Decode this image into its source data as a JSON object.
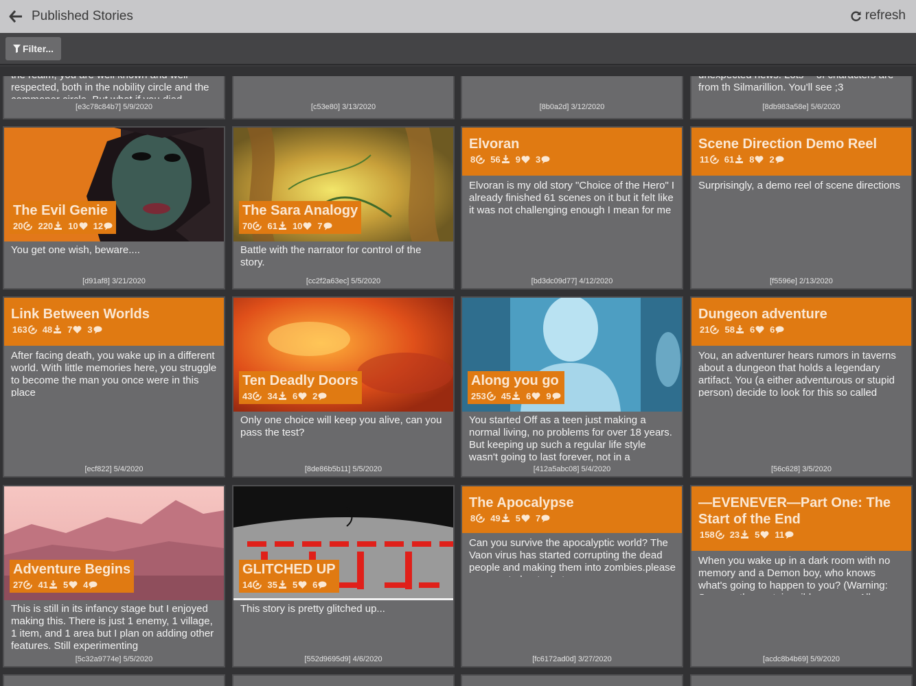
{
  "header": {
    "title": "Published Stories",
    "refresh_label": "refresh"
  },
  "toolbar": {
    "filter_label": "Filter..."
  },
  "partial_cards": [
    {
      "desc": "the realm, you are well known and well respected, both in the nobility circle and the commoner circle. But what if you died",
      "meta": "[e3c78c84b7] 5/9/2020"
    },
    {
      "desc": "",
      "meta": "[c53e80] 3/13/2020"
    },
    {
      "desc": "",
      "meta": "[8b0a2d] 3/12/2020"
    },
    {
      "desc": "unexpected news. Lots -- of characters are from th Silmarillion. You'll see ;3",
      "meta": "[8db983a58e] 5/6/2020"
    }
  ],
  "stories": [
    {
      "title": "The Evil Genie",
      "plays": "20",
      "downloads": "220",
      "likes": "10",
      "comments": "12",
      "desc": "You get one wish, beware....",
      "meta": "[d91af8] 3/21/2020"
    },
    {
      "title": "The Sara Analogy",
      "plays": "70",
      "downloads": "61",
      "likes": "10",
      "comments": "7",
      "desc": "Battle with the narrator for control of the story.",
      "meta": "[cc2f2a63ec] 5/5/2020"
    },
    {
      "title": "Elvoran",
      "plays": "8",
      "downloads": "56",
      "likes": "9",
      "comments": "3",
      "desc": "Elvoran is my old story \"Choice of the Hero\" I already finished 61 scenes on it but it felt like it was not challenging enough I mean for me it lacked challenge and",
      "meta": "[bd3dc09d77] 4/12/2020"
    },
    {
      "title": "Scene Direction Demo Reel",
      "plays": "11",
      "downloads": "61",
      "likes": "8",
      "comments": "2",
      "desc": "Surprisingly, a demo reel of scene directions",
      "meta": "[f5596e] 2/13/2020"
    },
    {
      "title": "Link Between Worlds",
      "plays": "163",
      "downloads": "48",
      "likes": "7",
      "comments": "3",
      "desc": "After facing death, you wake up in a different world. With little memories here, you struggle to become the man you once were in this place",
      "meta": "[ecf822] 5/4/2020"
    },
    {
      "title": "Ten Deadly Doors",
      "plays": "43",
      "downloads": "34",
      "likes": "6",
      "comments": "2",
      "desc": "Only one choice will keep you alive, can you pass the test?",
      "meta": "[8de86b5b11] 5/5/2020"
    },
    {
      "title": "Along you go",
      "plays": "253",
      "downloads": "45",
      "likes": "6",
      "comments": "9",
      "desc": "You started Off as a teen just making a normal living, no problems for over 18 years. But keeping up such a regular life style wasn't going to last forever, not in a",
      "meta": "[412a5abc08] 5/4/2020"
    },
    {
      "title": "Dungeon adventure",
      "plays": "21",
      "downloads": "58",
      "likes": "6",
      "comments": "6",
      "desc": "You, an adventurer hears rumors in taverns about a dungeon that holds a legendary artifact. You (a either adventurous or stupid person) decide to look for this so called",
      "meta": "[56c628] 3/5/2020"
    },
    {
      "title": "Adventure Begins",
      "plays": "27",
      "downloads": "41",
      "likes": "5",
      "comments": "4",
      "desc": "This is still in its infancy stage but I enjoyed making this. There is just 1 enemy, 1 village, 1 item, and 1 area but I plan on adding other features. Still experimenting",
      "meta": "[5c32a9774e] 5/5/2020"
    },
    {
      "title": "GLITCHED UP",
      "plays": "14",
      "downloads": "35",
      "likes": "5",
      "comments": "6",
      "desc": "This story is pretty glitched up...",
      "meta": "[552d9695d9] 4/6/2020"
    },
    {
      "title": "The Apocalypse",
      "plays": "8",
      "downloads": "49",
      "likes": "5",
      "comments": "7",
      "desc": "Can you survive the apocalyptic world? The Vaon virus has started corrupting the dead people and making them into zombies.please comment about what you",
      "meta": "[fc6172ad0d] 3/27/2020"
    },
    {
      "title": "—EVENEVER—Part One: The Start of the End",
      "plays": "158",
      "downloads": "23",
      "likes": "5",
      "comments": "11",
      "desc": "When you wake up in a dark room with no memory and a Demon boy, who knows what's going to happen to you? (Warning: Some paths contain mild romance. All",
      "meta": "[acdc8b4b69] 5/9/2020"
    }
  ],
  "colors": {
    "accent": "#e07a12",
    "card_bg": "#6a6a6c",
    "header_bg": "#c7c7c9",
    "page_bg": "#3a3a3c"
  },
  "icons": {
    "back": "arrow-left-icon",
    "refresh": "refresh-icon",
    "filter": "filter-icon",
    "plays": "play-count-icon",
    "downloads": "download-icon",
    "likes": "heart-icon",
    "comments": "comment-icon"
  }
}
